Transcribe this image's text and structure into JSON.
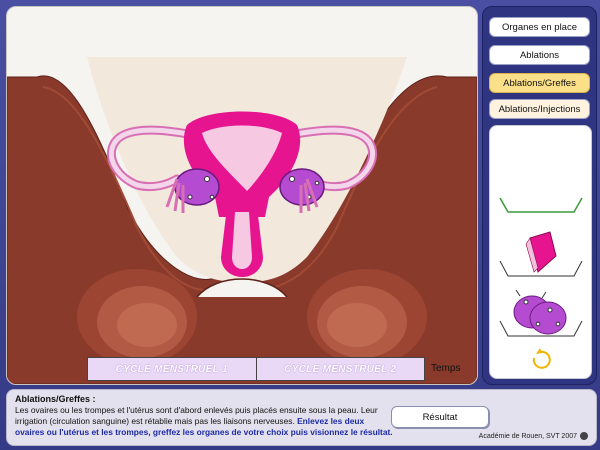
{
  "menu": {
    "items": [
      {
        "label": "Organes en place"
      },
      {
        "label": "Ablations"
      },
      {
        "label": "Ablations/Greffes",
        "active": true
      },
      {
        "label": "Ablations/Injections"
      }
    ]
  },
  "timeline": {
    "cells": [
      "CYCLE MENSTRUEL 1",
      "CYCLE MENSTRUEL 2"
    ],
    "temps_label": "Temps"
  },
  "footer": {
    "title": "Ablations/Greffes :",
    "text_part1": "Les ovaires ou les trompes et l'utérus sont d'abord enlevés puis placés ensuite sous la peau. Leur irrigation (circulation sanguine) est rétablie mais pas les liaisons nerveuses.",
    "text_part2": "Enlevez les deux ovaires ou l'utérus et les trompes, greffez les organes de votre choix  puis visionnez le résultat.",
    "result_label": "Résultat",
    "credit": "Académie de Rouen, SVT 2007"
  },
  "colors": {
    "accent_active": "#fbe089",
    "uterus_pink": "#e6148f",
    "ovary_purple": "#b44bd0",
    "skin_brown": "#8a3a2b"
  }
}
